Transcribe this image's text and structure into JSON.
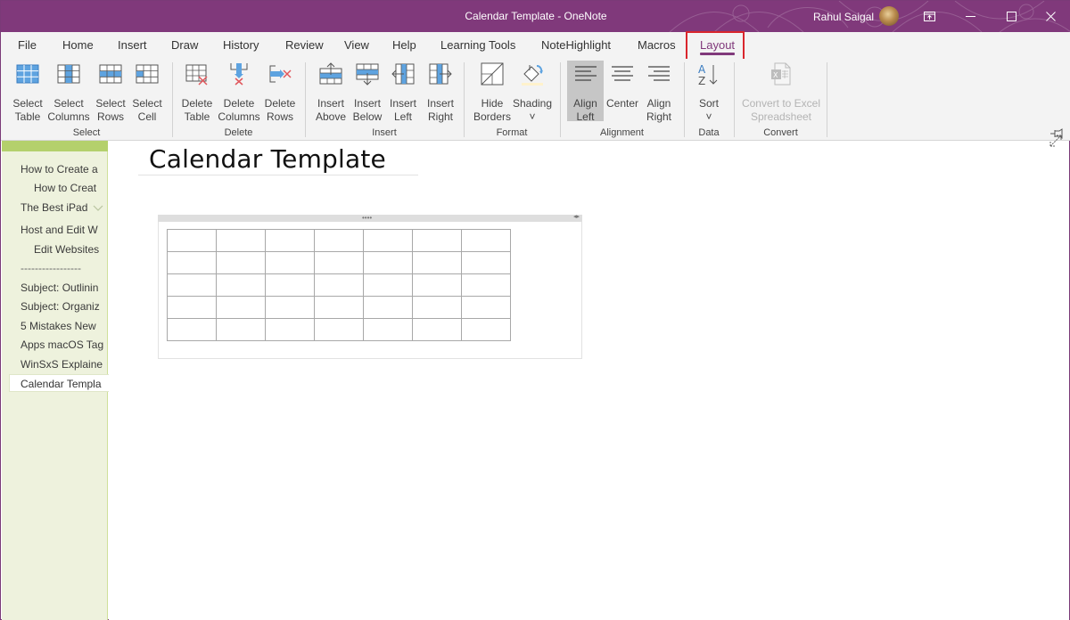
{
  "window": {
    "title": "Calendar Template - OneNote",
    "user_name": "Rahul Saigal",
    "controls": [
      "ribbon-display-options",
      "minimize",
      "maximize",
      "close"
    ]
  },
  "colors": {
    "brand": "#80397b",
    "highlight_box": "#d9262d",
    "section_tab": "#b4d06c",
    "sidebar_bg": "#eef2dd",
    "icon_blue": "#5ea3e0",
    "delete_red": "#e0575c"
  },
  "menu": {
    "tabs": [
      {
        "label": "File"
      },
      {
        "label": "Home"
      },
      {
        "label": "Insert"
      },
      {
        "label": "Draw"
      },
      {
        "label": "History"
      },
      {
        "label": "Review"
      },
      {
        "label": "View"
      },
      {
        "label": "Help"
      },
      {
        "label": "Learning Tools"
      },
      {
        "label": "NoteHighlight"
      },
      {
        "label": "Macros"
      },
      {
        "label": "Layout",
        "active": true
      }
    ]
  },
  "ribbon": {
    "groups": {
      "select": {
        "label": "Select",
        "buttons": [
          "Select\nTable",
          "Select\nColumns",
          "Select\nRows",
          "Select\nCell"
        ]
      },
      "delete": {
        "label": "Delete",
        "buttons": [
          "Delete\nTable",
          "Delete\nColumns",
          "Delete\nRows"
        ]
      },
      "insert": {
        "label": "Insert",
        "buttons": [
          "Insert\nAbove",
          "Insert\nBelow",
          "Insert\nLeft",
          "Insert\nRight"
        ]
      },
      "format": {
        "label": "Format",
        "buttons": [
          "Hide\nBorders",
          "Shading\n˅"
        ]
      },
      "alignment": {
        "label": "Alignment",
        "buttons": [
          "Align\nLeft",
          "Center",
          "Align\nRight"
        ],
        "selected": "Align Left"
      },
      "data": {
        "label": "Data",
        "buttons": [
          "Sort\n˅"
        ]
      },
      "convert": {
        "label": "Convert",
        "buttons": [
          "Convert to Excel\nSpreadsheet"
        ],
        "disabled": true
      }
    }
  },
  "pages": {
    "items": [
      {
        "label": "How to Create a",
        "indent": 0
      },
      {
        "label": "How to Creat",
        "indent": 1
      },
      {
        "label": "The Best iPad",
        "indent": 0,
        "collapsible": true
      },
      {
        "label": "Host and Edit W",
        "indent": 0
      },
      {
        "label": "Edit Websites",
        "indent": 1
      },
      {
        "label": "-----------------",
        "indent": 0
      },
      {
        "label": "Subject: Outlinin",
        "indent": 0
      },
      {
        "label": "Subject: Organiz",
        "indent": 0
      },
      {
        "label": "5 Mistakes New",
        "indent": 0
      },
      {
        "label": "Apps macOS Tag",
        "indent": 0
      },
      {
        "label": "WinSxS Explaine",
        "indent": 0
      },
      {
        "label": "Calendar Templa",
        "indent": 0,
        "current": true
      }
    ]
  },
  "note": {
    "title": "Calendar Template",
    "table": {
      "rows": 5,
      "columns": 7,
      "cells": [
        [
          "",
          "",
          "",
          "",
          "",
          "",
          ""
        ],
        [
          "",
          "",
          "",
          "",
          "",
          "",
          ""
        ],
        [
          "",
          "",
          "",
          "",
          "",
          "",
          ""
        ],
        [
          "",
          "",
          "",
          "",
          "",
          "",
          ""
        ],
        [
          "",
          "",
          "",
          "",
          "",
          "",
          ""
        ]
      ]
    },
    "handle_dots": "••••",
    "handle_arrows": "◂▸"
  }
}
